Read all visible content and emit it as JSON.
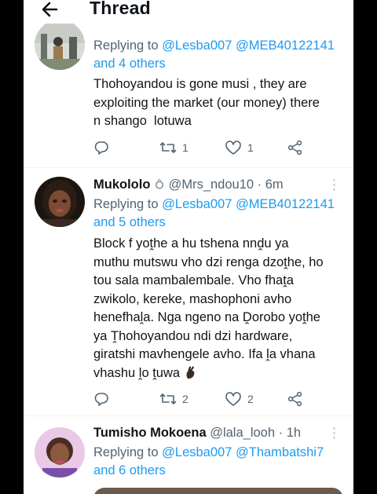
{
  "header": {
    "title": "Thread"
  },
  "tweets": [
    {
      "reply_prefix": "Replying to",
      "mentions": [
        "@Lesba007",
        "@MEB40122141"
      ],
      "and_others": "and 4 others",
      "text_lines": [
        "Thohoyandou is gone musi , they are",
        "exploiting the market (our money) there",
        "n shango  lotuwa"
      ],
      "retweets": "1",
      "likes": "1"
    },
    {
      "name": "Mukololo",
      "name_emoji": "ring",
      "handle": "@Mrs_ndou10",
      "time": "· 6m",
      "reply_prefix": "Replying to",
      "mentions": [
        "@Lesba007",
        "@MEB40122141"
      ],
      "and_others": "and 5 others",
      "text_lines": [
        "Block f yoṱhe a hu tshena nnḓu ya",
        "muthu mutswu vho dzi renga dzoṱhe, ho",
        "tou sala mambalembale. Vho fhaṱa",
        "zwikolo, kereke, mashophoni avho",
        "henefhaḽa. Nga ngeno na Ḓorobo yoṱhe",
        "ya Ṱhohoyandou ndi dzi hardware,",
        "giratshi mavhengele avho. Ifa ḽa vhana",
        "vhashu ḽo ṱuwa"
      ],
      "trailing_emoji": "crossed-fingers",
      "retweets": "2",
      "likes": "2"
    },
    {
      "name": "Tumisho Mokoena",
      "handle": "@lala_looh",
      "time": "· 1h",
      "reply_prefix": "Replying to",
      "mentions": [
        "@Lesba007",
        "@Thambatshi7"
      ],
      "and_others": "and 6 others"
    }
  ],
  "colors": {
    "accent": "#1d9bf0",
    "secondary_text": "#536471",
    "text": "#0f1419"
  }
}
